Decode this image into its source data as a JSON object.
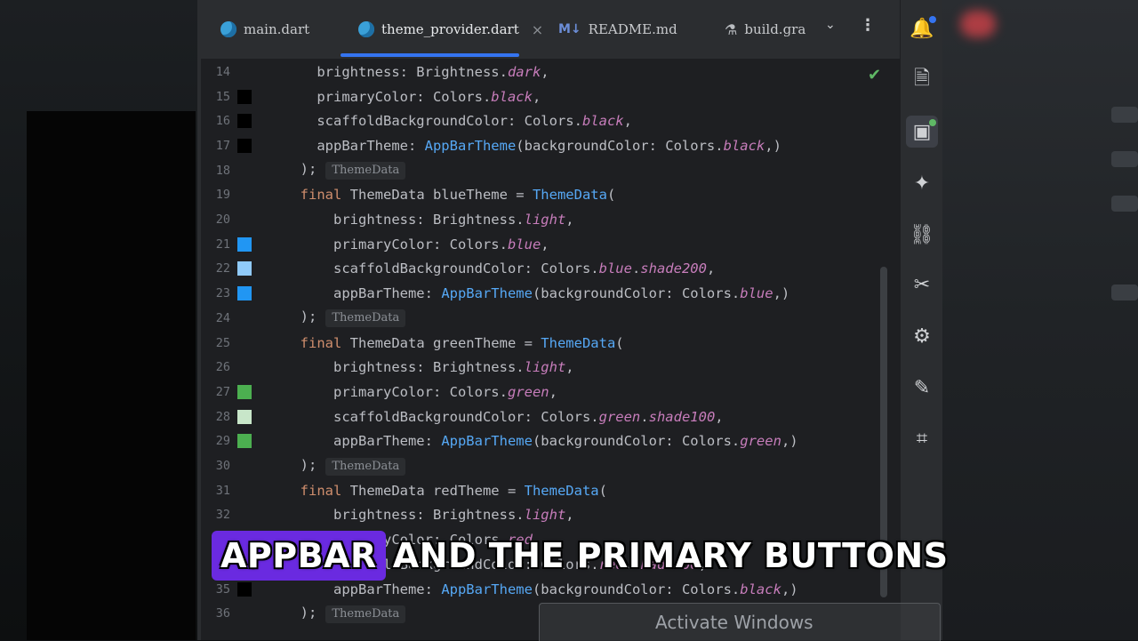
{
  "tabs": [
    {
      "label": "main.dart",
      "icon": "dart-file-icon"
    },
    {
      "label": "theme_provider.dart",
      "icon": "dart-file-icon",
      "active": true
    },
    {
      "label": "README.md",
      "icon": "markdown-file-icon"
    },
    {
      "label": "build.gra",
      "icon": "gradle-file-icon"
    }
  ],
  "tab_close": "×",
  "tab_more": "⌄",
  "tab_kebab": "⋮",
  "colors": {
    "accent": "#3574f0",
    "keyword": "#cf8e6d",
    "field": "#c77dbb",
    "class": "#56a8f5",
    "swatch_black": "#000000",
    "swatch_blue": "#2196f3",
    "swatch_blue_shade200": "#90caf9",
    "swatch_green": "#4caf50",
    "swatch_green_shade100": "#c8e6c9",
    "caption_highlight": "#6a2ae0"
  },
  "lines": [
    {
      "n": "14",
      "swatch": null,
      "segs": [
        [
          "p",
          "    brightness: Brightness."
        ],
        [
          "f",
          "dark"
        ],
        [
          "p",
          ","
        ]
      ]
    },
    {
      "n": "15",
      "swatch": "#000000",
      "segs": [
        [
          "p",
          "    primaryColor: Colors."
        ],
        [
          "f",
          "black"
        ],
        [
          "p",
          ","
        ]
      ]
    },
    {
      "n": "16",
      "swatch": "#000000",
      "segs": [
        [
          "p",
          "    scaffoldBackgroundColor: Colors."
        ],
        [
          "f",
          "black"
        ],
        [
          "p",
          ","
        ]
      ]
    },
    {
      "n": "17",
      "swatch": "#000000",
      "segs": [
        [
          "p",
          "    appBarTheme: "
        ],
        [
          "c",
          "AppBarTheme"
        ],
        [
          "p",
          "(backgroundColor: Colors."
        ],
        [
          "f",
          "black"
        ],
        [
          "p",
          ",)"
        ]
      ]
    },
    {
      "n": "18",
      "swatch": null,
      "segs": [
        [
          "p",
          "  );"
        ]
      ],
      "hint": "ThemeData"
    },
    {
      "n": "19",
      "swatch": null,
      "segs": [
        [
          "k",
          "  final"
        ],
        [
          "p",
          " ThemeData blueTheme = "
        ],
        [
          "c",
          "ThemeData"
        ],
        [
          "p",
          "("
        ]
      ]
    },
    {
      "n": "20",
      "swatch": null,
      "segs": [
        [
          "p",
          "      brightness: Brightness."
        ],
        [
          "f",
          "light"
        ],
        [
          "p",
          ","
        ]
      ]
    },
    {
      "n": "21",
      "swatch": "#2196f3",
      "segs": [
        [
          "p",
          "      primaryColor: Colors."
        ],
        [
          "f",
          "blue"
        ],
        [
          "p",
          ","
        ]
      ]
    },
    {
      "n": "22",
      "swatch": "#90caf9",
      "segs": [
        [
          "p",
          "      scaffoldBackgroundColor: Colors."
        ],
        [
          "f",
          "blue"
        ],
        [
          "p",
          "."
        ],
        [
          "f",
          "shade200"
        ],
        [
          "p",
          ","
        ]
      ]
    },
    {
      "n": "23",
      "swatch": "#2196f3",
      "segs": [
        [
          "p",
          "      appBarTheme: "
        ],
        [
          "c",
          "AppBarTheme"
        ],
        [
          "p",
          "(backgroundColor: Colors."
        ],
        [
          "f",
          "blue"
        ],
        [
          "p",
          ",)"
        ]
      ]
    },
    {
      "n": "24",
      "swatch": null,
      "segs": [
        [
          "p",
          "  );"
        ]
      ],
      "hint": "ThemeData"
    },
    {
      "n": "25",
      "swatch": null,
      "segs": [
        [
          "k",
          "  final"
        ],
        [
          "p",
          " ThemeData greenTheme = "
        ],
        [
          "c",
          "ThemeData"
        ],
        [
          "p",
          "("
        ]
      ]
    },
    {
      "n": "26",
      "swatch": null,
      "segs": [
        [
          "p",
          "      brightness: Brightness."
        ],
        [
          "f",
          "light"
        ],
        [
          "p",
          ","
        ]
      ]
    },
    {
      "n": "27",
      "swatch": "#4caf50",
      "segs": [
        [
          "p",
          "      primaryColor: Colors."
        ],
        [
          "f",
          "green"
        ],
        [
          "p",
          ","
        ]
      ]
    },
    {
      "n": "28",
      "swatch": "#c8e6c9",
      "segs": [
        [
          "p",
          "      scaffoldBackgroundColor: Colors."
        ],
        [
          "f",
          "green"
        ],
        [
          "p",
          "."
        ],
        [
          "f",
          "shade100"
        ],
        [
          "p",
          ","
        ]
      ]
    },
    {
      "n": "29",
      "swatch": "#4caf50",
      "segs": [
        [
          "p",
          "      appBarTheme: "
        ],
        [
          "c",
          "AppBarTheme"
        ],
        [
          "p",
          "(backgroundColor: Colors."
        ],
        [
          "f",
          "green"
        ],
        [
          "p",
          ",)"
        ]
      ]
    },
    {
      "n": "30",
      "swatch": null,
      "segs": [
        [
          "p",
          "  );"
        ]
      ],
      "hint": "ThemeData"
    },
    {
      "n": "31",
      "swatch": null,
      "segs": [
        [
          "k",
          "  final"
        ],
        [
          "p",
          " ThemeData redTheme = "
        ],
        [
          "c",
          "ThemeData"
        ],
        [
          "p",
          "("
        ]
      ]
    },
    {
      "n": "32",
      "swatch": null,
      "segs": [
        [
          "p",
          "      brightness: Brightness."
        ],
        [
          "f",
          "light"
        ],
        [
          "p",
          ","
        ]
      ]
    },
    {
      "n": "33",
      "swatch": null,
      "segs": [
        [
          "p",
          "      primaryColor: Colors."
        ],
        [
          "f",
          "red"
        ],
        [
          "p",
          ","
        ]
      ]
    },
    {
      "n": "34",
      "swatch": null,
      "segs": [
        [
          "p",
          "      scaffoldBackgroundColor: Colors."
        ],
        [
          "f",
          "red"
        ],
        [
          "p",
          "."
        ],
        [
          "f",
          "shade100"
        ],
        [
          "p",
          ","
        ]
      ]
    },
    {
      "n": "35",
      "swatch": "#000000",
      "segs": [
        [
          "p",
          "      appBarTheme: "
        ],
        [
          "c",
          "AppBarTheme"
        ],
        [
          "p",
          "(backgroundColor: Colors."
        ],
        [
          "f",
          "black"
        ],
        [
          "p",
          ",)"
        ]
      ]
    },
    {
      "n": "36",
      "swatch": null,
      "segs": [
        [
          "p",
          "  );"
        ]
      ],
      "hint": "ThemeData"
    }
  ],
  "tools": [
    {
      "name": "notifications-bell-icon",
      "glyph": "🔔",
      "dot": "blue"
    },
    {
      "name": "file-document-icon",
      "glyph": "🗎"
    },
    {
      "name": "device-manager-icon",
      "glyph": "▣",
      "selected": true,
      "dot": "green"
    },
    {
      "name": "gemini-sparkle-icon",
      "glyph": "✦"
    },
    {
      "name": "link-icon",
      "glyph": "⛓"
    },
    {
      "name": "tools-icon",
      "glyph": "✂"
    },
    {
      "name": "settings-badge-icon",
      "glyph": "⚙"
    },
    {
      "name": "pencil-icon",
      "glyph": "✎"
    },
    {
      "name": "screen-capture-icon",
      "glyph": "⌗"
    }
  ],
  "caption": {
    "highlight": "APPBAR",
    "rest": "AND THE PRIMARY BUTTONS"
  },
  "activate_windows": "Activate Windows",
  "status_check": "✔"
}
